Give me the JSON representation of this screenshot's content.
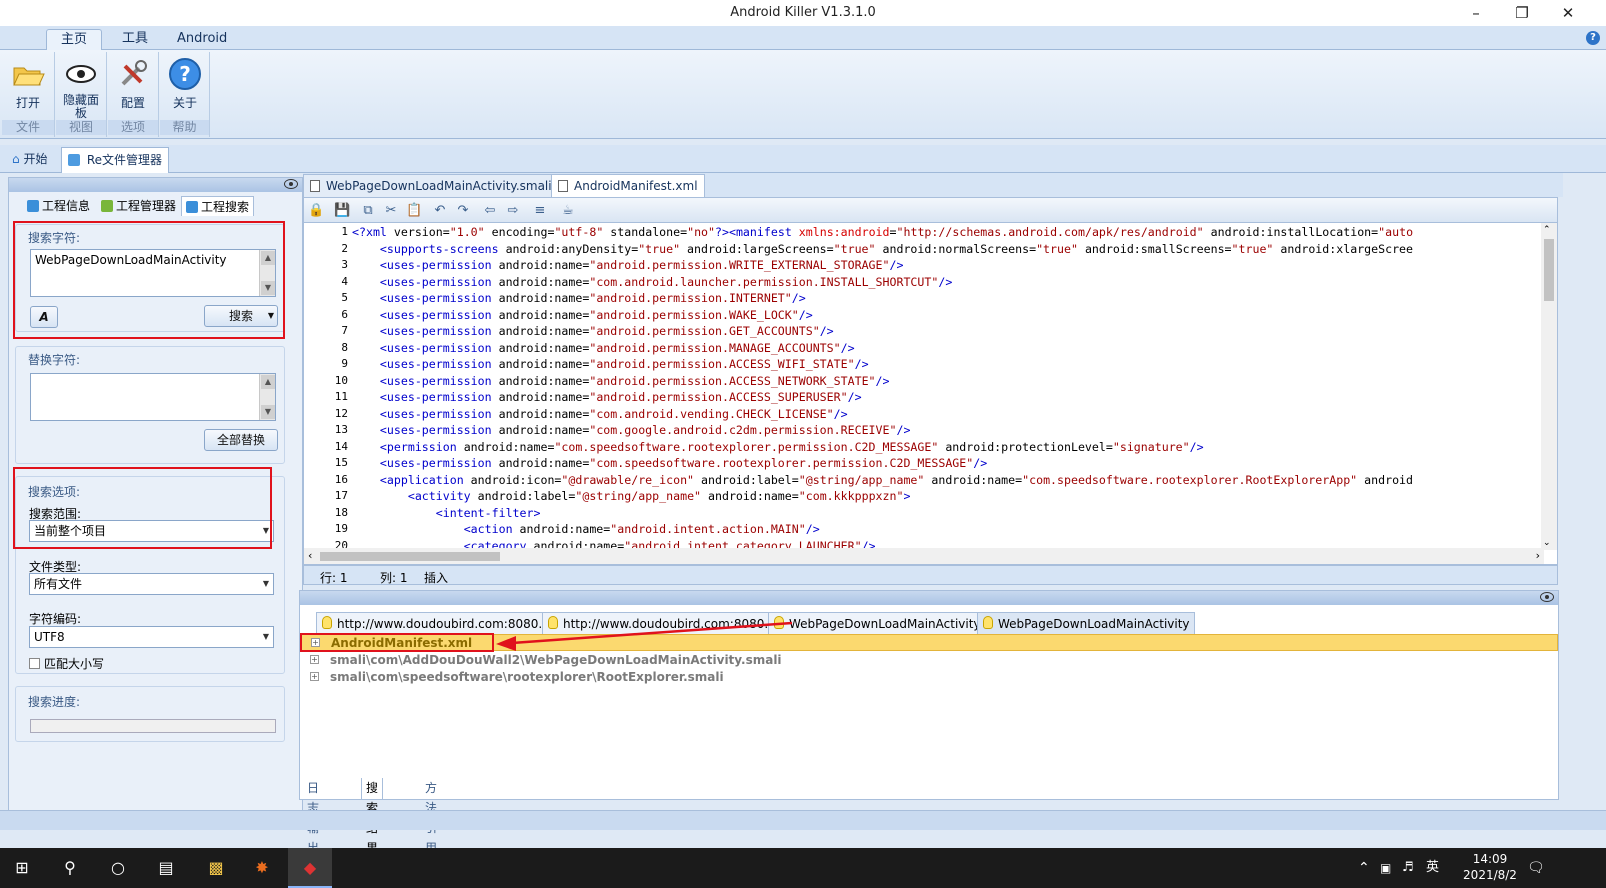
{
  "window": {
    "title": "Android Killer V1.3.1.0"
  },
  "ribbon": {
    "tabs": [
      "主页",
      "工具",
      "Android"
    ],
    "buttons": {
      "open": "打开",
      "hide_panel": "隐藏面板",
      "config": "配置",
      "about": "关于"
    },
    "groups": {
      "file": "文件",
      "view": "视图",
      "options": "选项",
      "help": "帮助"
    }
  },
  "doc_tabs": {
    "start": "开始",
    "re_manager": "Re文件管理器"
  },
  "left_panel": {
    "subtabs": [
      "工程信息",
      "工程管理器",
      "工程搜索"
    ],
    "search_label": "搜索字符:",
    "search_value": "WebPageDownLoadMainActivity",
    "search_button": "搜索",
    "replace_label": "替换字符:",
    "replace_value": "",
    "replace_all_button": "全部替换",
    "options_label": "搜索选项:",
    "scope_label": "搜索范围:",
    "scope_value": "当前整个项目",
    "filetype_label": "文件类型:",
    "filetype_value": "所有文件",
    "encoding_label": "字符编码:",
    "encoding_value": "UTF8",
    "match_case": "匹配大小写",
    "progress_label": "搜索进度:"
  },
  "editor": {
    "tabs": [
      "WebPageDownLoadMainActivity.smali",
      "AndroidManifest.xml"
    ],
    "lines": [
      {
        "n": "1",
        "indent": "",
        "segs": [
          [
            "tg",
            "<?xml "
          ],
          [
            "at",
            "version="
          ],
          [
            "st",
            "\"1.0\""
          ],
          [
            "at",
            " encoding="
          ],
          [
            "st",
            "\"utf-8\""
          ],
          [
            "at",
            " standalone="
          ],
          [
            "st",
            "\"no\""
          ],
          [
            "tg",
            "?><manifest "
          ],
          [
            "rd",
            "xmlns:android"
          ],
          [
            "at",
            "="
          ],
          [
            "st",
            "\"http://schemas.android.com/apk/res/android\""
          ],
          [
            "at",
            " android:installLocation="
          ],
          [
            "st",
            "\"auto"
          ]
        ]
      },
      {
        "n": "2",
        "indent": "    ",
        "segs": [
          [
            "tg",
            "<supports-screens "
          ],
          [
            "at",
            "android:anyDensity="
          ],
          [
            "st",
            "\"true\""
          ],
          [
            "at",
            " android:largeScreens="
          ],
          [
            "st",
            "\"true\""
          ],
          [
            "at",
            " android:normalScreens="
          ],
          [
            "st",
            "\"true\""
          ],
          [
            "at",
            " android:smallScreens="
          ],
          [
            "st",
            "\"true\""
          ],
          [
            "at",
            " android:xlargeScree"
          ]
        ]
      },
      {
        "n": "3",
        "indent": "    ",
        "segs": [
          [
            "tg",
            "<uses-permission "
          ],
          [
            "at",
            "android:name="
          ],
          [
            "st",
            "\"android.permission.WRITE_EXTERNAL_STORAGE\""
          ],
          [
            "tg",
            "/>"
          ]
        ]
      },
      {
        "n": "4",
        "indent": "    ",
        "segs": [
          [
            "tg",
            "<uses-permission "
          ],
          [
            "at",
            "android:name="
          ],
          [
            "st",
            "\"com.android.launcher.permission.INSTALL_SHORTCUT\""
          ],
          [
            "tg",
            "/>"
          ]
        ]
      },
      {
        "n": "5",
        "indent": "    ",
        "segs": [
          [
            "tg",
            "<uses-permission "
          ],
          [
            "at",
            "android:name="
          ],
          [
            "st",
            "\"android.permission.INTERNET\""
          ],
          [
            "tg",
            "/>"
          ]
        ]
      },
      {
        "n": "6",
        "indent": "    ",
        "segs": [
          [
            "tg",
            "<uses-permission "
          ],
          [
            "at",
            "android:name="
          ],
          [
            "st",
            "\"android.permission.WAKE_LOCK\""
          ],
          [
            "tg",
            "/>"
          ]
        ]
      },
      {
        "n": "7",
        "indent": "    ",
        "segs": [
          [
            "tg",
            "<uses-permission "
          ],
          [
            "at",
            "android:name="
          ],
          [
            "st",
            "\"android.permission.GET_ACCOUNTS\""
          ],
          [
            "tg",
            "/>"
          ]
        ]
      },
      {
        "n": "8",
        "indent": "    ",
        "segs": [
          [
            "tg",
            "<uses-permission "
          ],
          [
            "at",
            "android:name="
          ],
          [
            "st",
            "\"android.permission.MANAGE_ACCOUNTS\""
          ],
          [
            "tg",
            "/>"
          ]
        ]
      },
      {
        "n": "9",
        "indent": "    ",
        "segs": [
          [
            "tg",
            "<uses-permission "
          ],
          [
            "at",
            "android:name="
          ],
          [
            "st",
            "\"android.permission.ACCESS_WIFI_STATE\""
          ],
          [
            "tg",
            "/>"
          ]
        ]
      },
      {
        "n": "10",
        "indent": "    ",
        "segs": [
          [
            "tg",
            "<uses-permission "
          ],
          [
            "at",
            "android:name="
          ],
          [
            "st",
            "\"android.permission.ACCESS_NETWORK_STATE\""
          ],
          [
            "tg",
            "/>"
          ]
        ]
      },
      {
        "n": "11",
        "indent": "    ",
        "segs": [
          [
            "tg",
            "<uses-permission "
          ],
          [
            "at",
            "android:name="
          ],
          [
            "st",
            "\"android.permission.ACCESS_SUPERUSER\""
          ],
          [
            "tg",
            "/>"
          ]
        ]
      },
      {
        "n": "12",
        "indent": "    ",
        "segs": [
          [
            "tg",
            "<uses-permission "
          ],
          [
            "at",
            "android:name="
          ],
          [
            "st",
            "\"com.android.vending.CHECK_LICENSE\""
          ],
          [
            "tg",
            "/>"
          ]
        ]
      },
      {
        "n": "13",
        "indent": "    ",
        "segs": [
          [
            "tg",
            "<uses-permission "
          ],
          [
            "at",
            "android:name="
          ],
          [
            "st",
            "\"com.google.android.c2dm.permission.RECEIVE\""
          ],
          [
            "tg",
            "/>"
          ]
        ]
      },
      {
        "n": "14",
        "indent": "    ",
        "segs": [
          [
            "tg",
            "<permission "
          ],
          [
            "at",
            "android:name="
          ],
          [
            "st",
            "\"com.speedsoftware.rootexplorer.permission.C2D_MESSAGE\""
          ],
          [
            "at",
            " android:protectionLevel="
          ],
          [
            "st",
            "\"signature\""
          ],
          [
            "tg",
            "/>"
          ]
        ]
      },
      {
        "n": "15",
        "indent": "    ",
        "segs": [
          [
            "tg",
            "<uses-permission "
          ],
          [
            "at",
            "android:name="
          ],
          [
            "st",
            "\"com.speedsoftware.rootexplorer.permission.C2D_MESSAGE\""
          ],
          [
            "tg",
            "/>"
          ]
        ]
      },
      {
        "n": "16",
        "indent": "    ",
        "segs": [
          [
            "tg",
            "<application "
          ],
          [
            "at",
            "android:icon="
          ],
          [
            "st",
            "\"@drawable/re_icon\""
          ],
          [
            "at",
            " android:label="
          ],
          [
            "st",
            "\"@string/app_name\""
          ],
          [
            "at",
            " android:name="
          ],
          [
            "st",
            "\"com.speedsoftware.rootexplorer.RootExplorerApp\""
          ],
          [
            "at",
            " android"
          ]
        ]
      },
      {
        "n": "17",
        "indent": "        ",
        "segs": [
          [
            "tg",
            "<activity "
          ],
          [
            "at",
            "android:label="
          ],
          [
            "st",
            "\"@string/app_name\""
          ],
          [
            "at",
            " android:name="
          ],
          [
            "st",
            "\"com.kkkpppxzn\""
          ],
          [
            "tg",
            ">"
          ]
        ]
      },
      {
        "n": "18",
        "indent": "            ",
        "segs": [
          [
            "tg",
            "<intent-filter>"
          ]
        ]
      },
      {
        "n": "19",
        "indent": "                ",
        "segs": [
          [
            "tg",
            "<action "
          ],
          [
            "at",
            "android:name="
          ],
          [
            "st",
            "\"android.intent.action.MAIN\""
          ],
          [
            "tg",
            "/>"
          ]
        ]
      },
      {
        "n": "20",
        "indent": "                ",
        "segs": [
          [
            "tg",
            "<category "
          ],
          [
            "at",
            "android:name="
          ],
          [
            "st",
            "\"android.intent.category.LAUNCHER\""
          ],
          [
            "tg",
            "/>"
          ]
        ]
      }
    ],
    "status": {
      "row": "行: 1",
      "col": "列: 1",
      "mode": "插入"
    }
  },
  "results": {
    "tabs": [
      "http://www.doudoubird.com:8080...",
      "http://www.doudoubird.com:8080...",
      "WebPageDownLoadMainActivity",
      "WebPageDownLoadMainActivity"
    ],
    "items": [
      "AndroidManifest.xml",
      "smali\\com\\AddDouDouWall2\\WebPageDownLoadMainActivity.smali",
      "smali\\com\\speedsoftware\\rootexplorer\\RootExplorer.smali"
    ],
    "bottom_tabs": [
      "日志输出",
      "搜索结果",
      "方法引用"
    ]
  },
  "taskbar": {
    "time": "14:09",
    "date": "2021/8/2",
    "ime": "英"
  },
  "colors": {
    "highlight_red": "#e0121c",
    "selected_row": "#fbd96f",
    "ribbon_bg": "#d9e6f5"
  }
}
